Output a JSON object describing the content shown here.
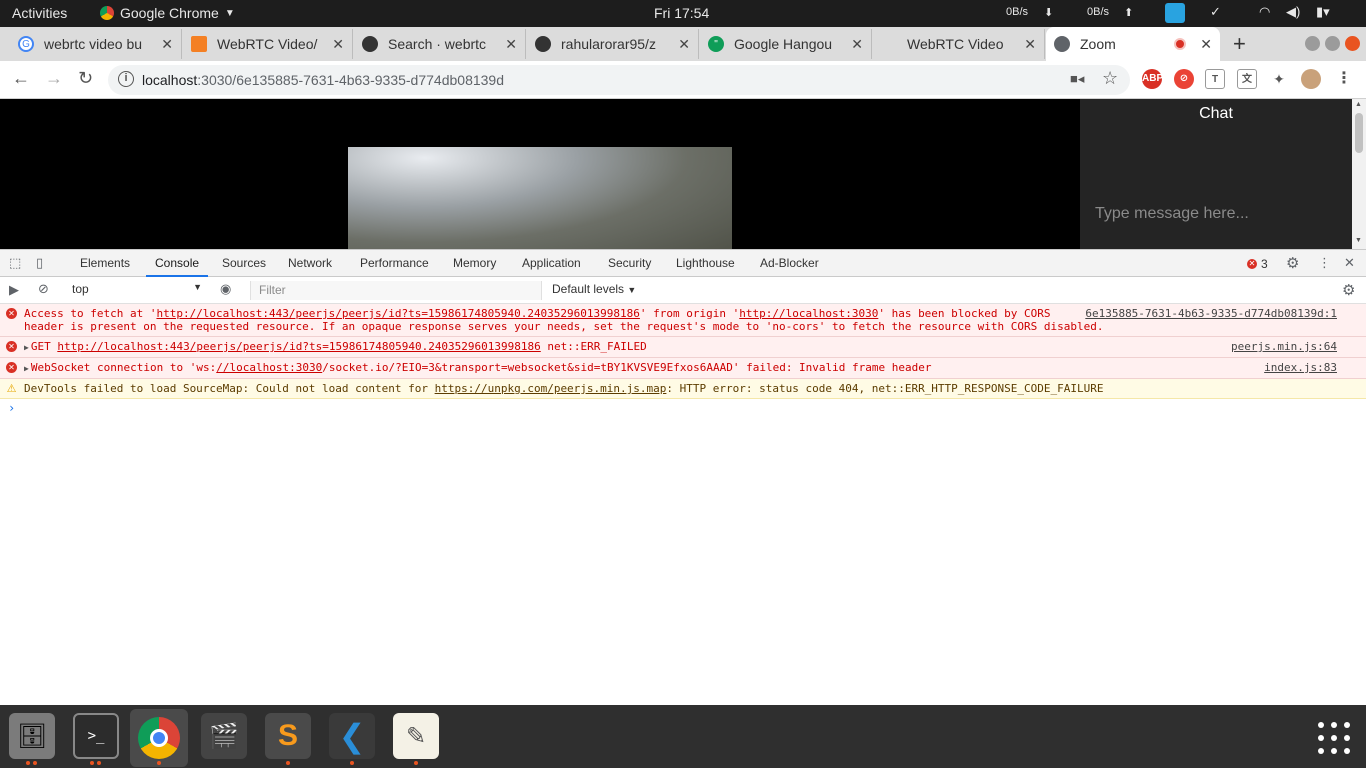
{
  "topbar": {
    "activities": "Activities",
    "app_name": "Google Chrome",
    "clock": "Fri 17:54",
    "net_down": "0B/s",
    "net_up": "0B/s"
  },
  "tabs": [
    {
      "title": "webrtc video bu",
      "favicon": "google-icon"
    },
    {
      "title": "WebRTC Video/",
      "favicon": "stackoverflow-icon"
    },
    {
      "title": "Search · webrtc",
      "favicon": "github-icon"
    },
    {
      "title": "rahularorar95/z",
      "favicon": "github-icon"
    },
    {
      "title": "Google Hangou",
      "favicon": "hangouts-icon"
    },
    {
      "title": "WebRTC Video",
      "favicon": "blank-icon"
    },
    {
      "title": "Zoom",
      "favicon": "globe-icon"
    }
  ],
  "omnibox": {
    "host": "localhost",
    "path": ":3030/6e135885-7631-4b63-9335-d774db08139d"
  },
  "page": {
    "chat_title": "Chat",
    "chat_placeholder": "Type message here..."
  },
  "devtools": {
    "tabs": [
      "Elements",
      "Console",
      "Sources",
      "Network",
      "Performance",
      "Memory",
      "Application",
      "Security",
      "Lighthouse",
      "Ad-Blocker"
    ],
    "active_tab": "Console",
    "error_count": "3",
    "context": "top",
    "filter_placeholder": "Filter",
    "levels": "Default levels"
  },
  "console": {
    "msg1": {
      "p1": "Access to fetch at '",
      "link1": "http://localhost:443/peerjs/peerjs/id?ts=15986174805940.24035296013998186",
      "p2": "' from origin '",
      "link2": "http://localhost:3030",
      "p3": "' has been blocked by CORS policy: No 'Access-Control-Allow-Origin' header is present on the requested resource. If an opaque response serves your needs, set the request's mode to 'no-cors' to fetch the resource with CORS disabled.",
      "source": "6e135885-7631-4b63-9335-d774db08139d:1"
    },
    "msg2": {
      "p1": "GET ",
      "link1": "http://localhost:443/peerjs/peerjs/id?ts=15986174805940.24035296013998186",
      "p2": " net::ERR_FAILED",
      "source": "peerjs.min.js:64"
    },
    "msg3": {
      "p1": "WebSocket connection to 'ws:",
      "link1": "//localhost:3030",
      "p2": "/socket.io/?EIO=3&transport=websocket&sid=tBY1KVSVE9Efxos6AAAD' failed: Invalid frame header",
      "source": "index.js:83"
    },
    "msg4": {
      "p1": "DevTools failed to load SourceMap: Could not load content for ",
      "link1": "https://unpkg.com/peerjs.min.js.map",
      "p2": ": HTTP error: status code 404, net::ERR_HTTP_RESPONSE_CODE_FAILURE"
    }
  },
  "dock": [
    "files-icon",
    "terminal-icon",
    "chrome-icon",
    "video-editor-icon",
    "sublime-text-icon",
    "vscode-icon",
    "text-editor-icon"
  ]
}
